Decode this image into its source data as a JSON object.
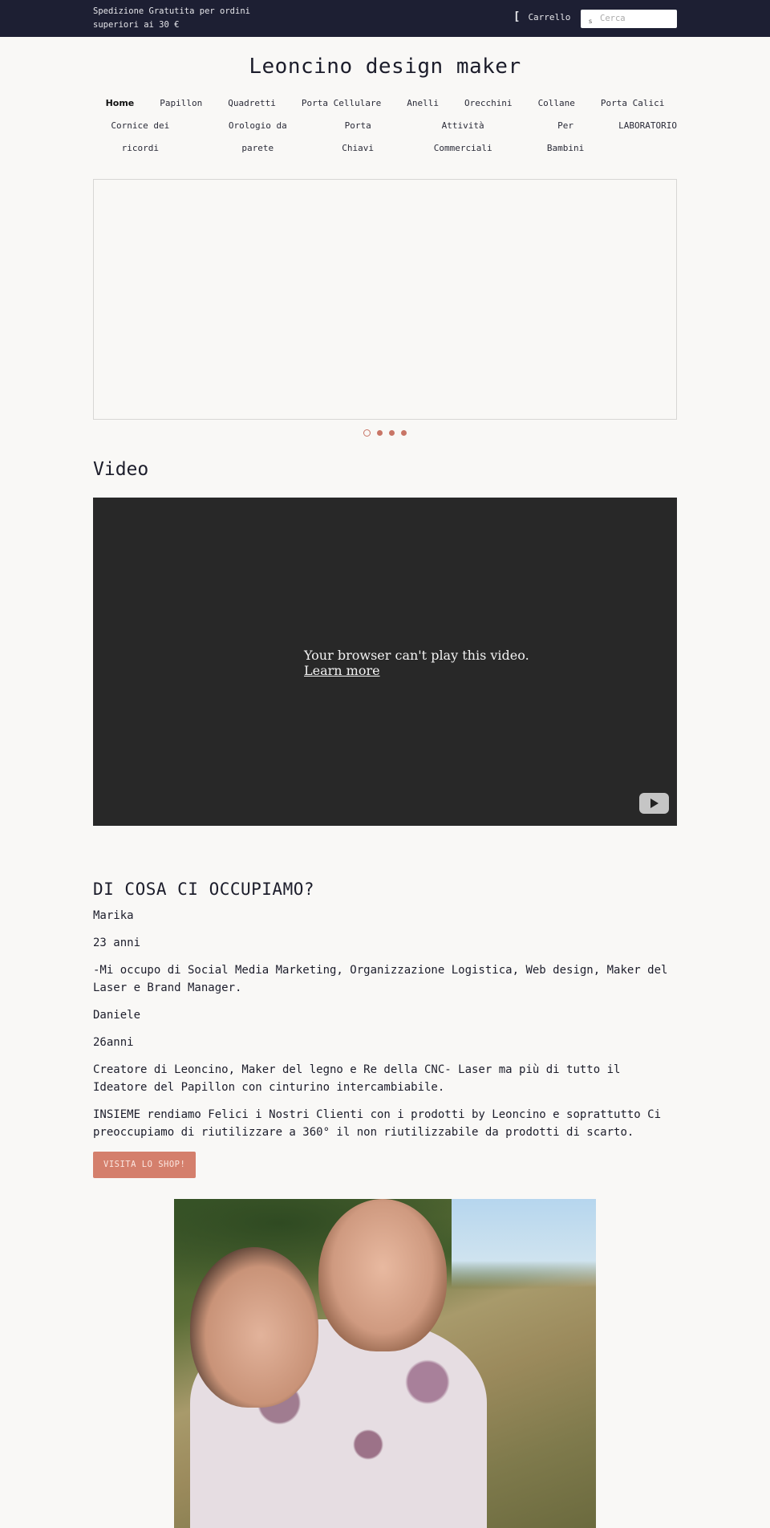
{
  "topbar": {
    "promo_line1": "Spedizione Gratutita per ordini",
    "promo_line2": "superiori ai 30 €",
    "cart_icon": "cart-icon",
    "cart_label": "Carrello",
    "search_icon": "search-icon",
    "search_placeholder": "Cerca",
    "search_value": ""
  },
  "header": {
    "site_title": "Leoncino design maker"
  },
  "nav": {
    "row1": [
      {
        "label": "Home",
        "active": true
      },
      {
        "label": "Papillon"
      },
      {
        "label": "Quadretti"
      },
      {
        "label": "Porta Cellulare"
      },
      {
        "label": "Anelli"
      },
      {
        "label": "Orecchini"
      },
      {
        "label": "Collane"
      },
      {
        "label": "Porta Calici"
      }
    ],
    "row2": [
      {
        "label": "Cornice dei ricordi"
      },
      {
        "label": "Orologio da parete"
      },
      {
        "label": "Porta Chiavi"
      },
      {
        "label": "Attività Commerciali"
      },
      {
        "label": "Per Bambini"
      },
      {
        "label": "LABORATORIO"
      }
    ]
  },
  "slideshow": {
    "slide_count": 4,
    "active_index": 0,
    "accent_color": "#c87566"
  },
  "video_section": {
    "title": "Video",
    "message": "Your browser can't play this video.",
    "learn_more": "Learn more",
    "play_icon": "youtube-play-icon"
  },
  "about": {
    "title": "DI COSA CI OCCUPIAMO?",
    "paragraphs": [
      "Marika",
      "23 anni",
      "-Mi occupo di Social Media Marketing, Organizzazione Logistica, Web design, Maker del Laser e Brand Manager.",
      "Daniele",
      "26anni",
      "Creatore di Leoncino, Maker del legno e Re della CNC- Laser ma più di tutto il Ideatore del Papillon con cinturino intercambiabile.",
      "INSIEME rendiamo Felici i Nostri Clienti con i prodotti by Leoncino e soprattutto Ci preoccupiamo di riutilizzare a 360° il non riutilizzabile da prodotti di scarto."
    ],
    "shop_button": "VISITA LO SHOP!",
    "button_color": "#d47f6c"
  },
  "photo": {
    "alt": "Foto di Marika e Daniele all'aperto"
  },
  "colors": {
    "topbar_bg": "#1d1f33",
    "page_bg": "#f9f8f6",
    "text": "#1c1d2b",
    "video_bg": "#282828"
  }
}
